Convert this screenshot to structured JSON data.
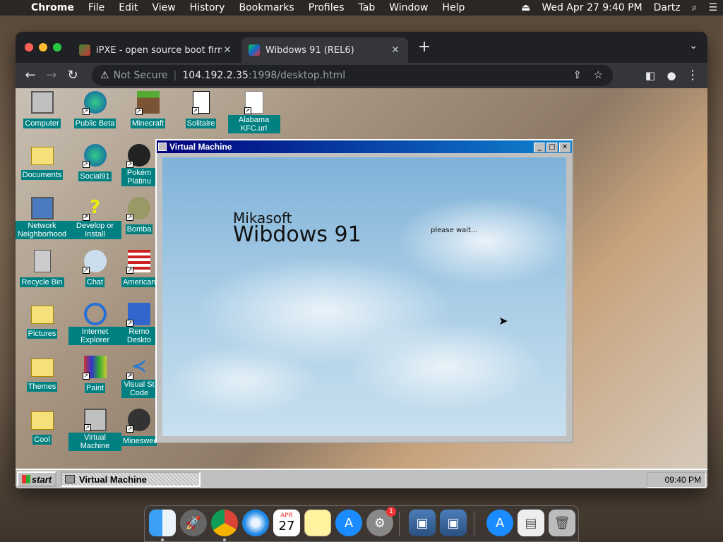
{
  "menubar": {
    "app_name": "Chrome",
    "items": [
      "File",
      "Edit",
      "View",
      "History",
      "Bookmarks",
      "Profiles",
      "Tab",
      "Window",
      "Help"
    ],
    "clock": "Wed Apr 27  9:40 PM",
    "user": "Dartz"
  },
  "browser": {
    "tabs": [
      {
        "title": "iPXE - open source boot firmware"
      },
      {
        "title": "Wibdows 91 (REL6)"
      }
    ],
    "security": "Not Secure",
    "url_host": "104.192.2.35",
    "url_rest": ":1998/desktop.html"
  },
  "desktop": {
    "icons": [
      {
        "label": "Computer"
      },
      {
        "label": "Public Beta"
      },
      {
        "label": "Minecraft"
      },
      {
        "label": "Solitaire"
      },
      {
        "label": "Alabama KFC.url"
      },
      {
        "label": "Documents"
      },
      {
        "label": "Social91"
      },
      {
        "label": "Pokém Platinu"
      },
      {
        "label": "Network Neighborhood"
      },
      {
        "label": "Develop or Install"
      },
      {
        "label": "Bomba"
      },
      {
        "label": "Recycle Bin"
      },
      {
        "label": "Chat"
      },
      {
        "label": "American"
      },
      {
        "label": "Pictures"
      },
      {
        "label": "Internet Explorer"
      },
      {
        "label": "Remo Deskto"
      },
      {
        "label": "Themes"
      },
      {
        "label": "Paint"
      },
      {
        "label": "Visual St Code"
      },
      {
        "label": "Cool"
      },
      {
        "label": "Virtual Machine"
      },
      {
        "label": "Minesweep"
      }
    ]
  },
  "vm_window": {
    "title": "Virtual Machine",
    "brand_small": "Mikasoft",
    "brand_large": "Wibdows 91",
    "status": "please wait..."
  },
  "taskbar": {
    "start_label": "start",
    "task_label": "Virtual Machine",
    "clock": "09:40 PM"
  },
  "dock": {
    "calendar_month": "APR",
    "calendar_day": "27",
    "badge": "1"
  }
}
